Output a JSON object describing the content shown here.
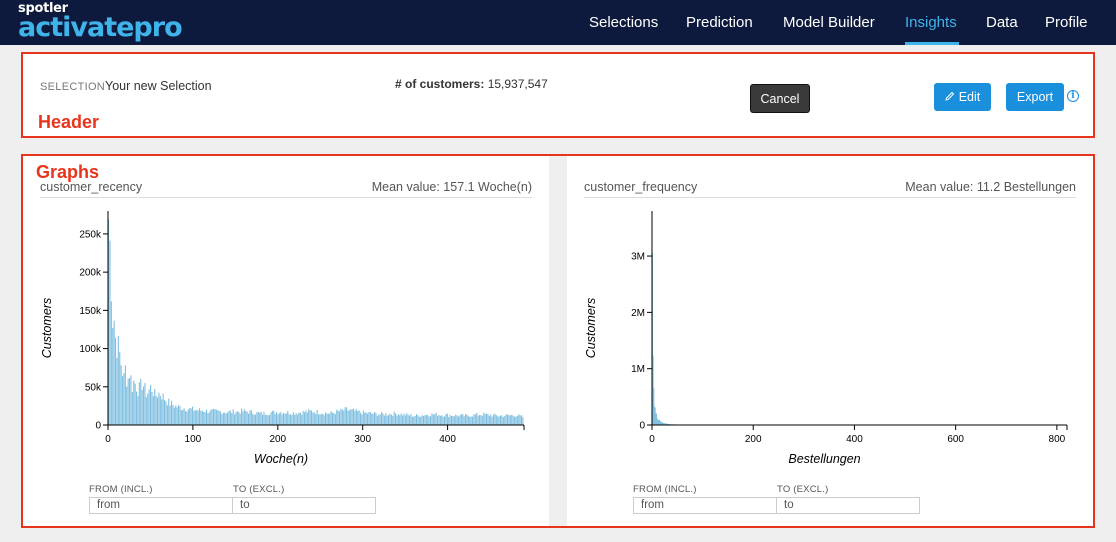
{
  "brand": {
    "small": "spotler",
    "big": "activatepro"
  },
  "nav": {
    "items": [
      {
        "label": "Selections",
        "active": false
      },
      {
        "label": "Prediction",
        "active": false
      },
      {
        "label": "Model Builder",
        "active": false
      },
      {
        "label": "Insights",
        "active": true
      },
      {
        "label": "Data",
        "active": false
      },
      {
        "label": "Profile",
        "active": false
      }
    ]
  },
  "header": {
    "annotation": "Header",
    "selection_label": "SELECTION",
    "selection_name": "Your new Selection",
    "customers_label": "# of customers:",
    "customers_value": "15,937,547",
    "cancel_label": "Cancel",
    "edit_label": "Edit",
    "export_label": "Export",
    "info_icon": "info-icon"
  },
  "graphs": {
    "annotation": "Graphs",
    "cards": [
      {
        "title": "customer_recency",
        "mean": "Mean value: 157.1 Woche(n)",
        "from_label": "FROM (INCL.)",
        "to_label": "TO (EXCL.)",
        "from_placeholder": "from",
        "to_placeholder": "to"
      },
      {
        "title": "customer_frequency",
        "mean": "Mean value: 11.2 Bestellungen",
        "from_label": "FROM (INCL.)",
        "to_label": "TO (EXCL.)",
        "from_placeholder": "from",
        "to_placeholder": "to"
      }
    ]
  },
  "colors": {
    "bar": "#7fbfe0",
    "accent": "#1a8fdb",
    "nav_bg": "#0e1a3d",
    "annotation": "#e8341c"
  },
  "chart_data": [
    {
      "type": "bar",
      "name": "customer_recency",
      "xlabel": "Woche(n)",
      "ylabel": "Customers",
      "xlim": [
        0,
        490
      ],
      "ylim": [
        0,
        280000
      ],
      "xticks": [
        0,
        100,
        200,
        300,
        400
      ],
      "xtick_labels": [
        "0",
        "100",
        "200",
        "300",
        "400"
      ],
      "yticks": [
        0,
        50000,
        100000,
        150000,
        200000,
        250000
      ],
      "ytick_labels": [
        "0",
        "50k",
        "100k",
        "150k",
        "200k",
        "250k"
      ],
      "x": [
        0,
        1,
        2,
        3,
        4,
        5,
        6,
        8,
        10,
        12,
        15,
        18,
        20,
        22,
        25,
        28,
        30,
        35,
        40,
        45,
        50,
        55,
        60,
        70,
        80,
        90,
        100,
        120,
        140,
        160,
        180,
        200,
        220,
        240,
        260,
        280,
        300,
        320,
        340,
        360,
        380,
        400,
        420,
        440,
        460,
        480,
        489
      ],
      "values": [
        270000,
        255000,
        225000,
        200000,
        170000,
        140000,
        150000,
        115000,
        105000,
        100000,
        80000,
        60000,
        75000,
        55000,
        70000,
        50000,
        58000,
        45000,
        55000,
        40000,
        50000,
        38000,
        42000,
        30000,
        24000,
        22000,
        20000,
        18000,
        17000,
        18000,
        15000,
        17000,
        16000,
        18000,
        15000,
        20000,
        16000,
        14000,
        15000,
        12000,
        14000,
        13000,
        12000,
        14000,
        12000,
        13000,
        10000
      ]
    },
    {
      "type": "bar",
      "name": "customer_frequency",
      "xlabel": "Bestellungen",
      "ylabel": "Customers",
      "xlim": [
        0,
        820
      ],
      "ylim": [
        0,
        3800000
      ],
      "xticks": [
        0,
        200,
        400,
        600,
        800
      ],
      "xtick_labels": [
        "0",
        "200",
        "400",
        "600",
        "800"
      ],
      "yticks": [
        0,
        1000000,
        2000000,
        3000000
      ],
      "ytick_labels": [
        "0",
        "1M",
        "2M",
        "3M"
      ],
      "x": [
        0,
        1,
        2,
        3,
        4,
        5,
        6,
        8,
        10,
        12,
        15,
        20,
        25,
        30,
        40,
        50,
        60,
        80,
        100
      ],
      "values": [
        3800000,
        1500000,
        900000,
        600000,
        420000,
        320000,
        250000,
        180000,
        130000,
        100000,
        70000,
        45000,
        30000,
        20000,
        12000,
        8000,
        5000,
        3000,
        1500
      ]
    }
  ]
}
